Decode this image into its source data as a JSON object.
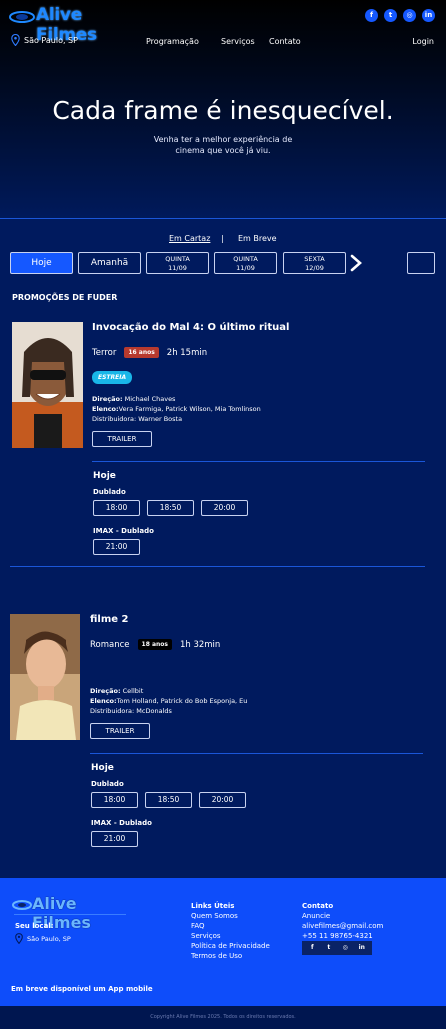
{
  "header": {
    "logo_text": "Alive Filmes",
    "socials": [
      {
        "icon": "facebook-icon",
        "glyph": "f"
      },
      {
        "icon": "twitter-icon",
        "glyph": "t"
      },
      {
        "icon": "instagram-icon",
        "glyph": "◎"
      },
      {
        "icon": "linkedin-icon",
        "glyph": "in"
      }
    ],
    "location": "São Paulo, SP",
    "nav": {
      "programacao": "Programação",
      "servicos": "Serviços",
      "contato": "Contato",
      "login": "Login"
    }
  },
  "hero": {
    "title": "Cada frame é inesquecível.",
    "subtitle": "Venha ter a melhor experiência de cinema que você já viu."
  },
  "tabs": {
    "em_cartaz": "Em Cartaz",
    "separator": "|",
    "em_breve": "Em Breve"
  },
  "dates": [
    {
      "label": "Hoje",
      "sub": ""
    },
    {
      "label": "Amanhã",
      "sub": ""
    },
    {
      "label": "QUINTA",
      "sub": "11/09"
    },
    {
      "label": "QUINTA",
      "sub": "11/09"
    },
    {
      "label": "SEXTA",
      "sub": "12/09"
    }
  ],
  "section_title": "PROMOÇÕES DE FUDER",
  "movies": [
    {
      "title": "Invocação do Mal 4: O último ritual",
      "genre": "Terror",
      "rating": "16 anos",
      "rating_color": "#c0392b",
      "duration": "2h 15min",
      "badge": "ESTREIA",
      "direcao_label": "Direção:",
      "direcao": " Michael Chaves",
      "elenco_label": "Elenco:",
      "elenco": "Vera Farmiga, Patrick Wilson, Mia Tomlinson",
      "distribuidora": "Distribuidora: Warner Bosta",
      "trailer": "TRAILER",
      "day": "Hoje",
      "sessions": [
        {
          "type": "Dublado",
          "times": [
            "18:00",
            "18:50",
            "20:00"
          ]
        },
        {
          "type": "IMAX - Dublado",
          "times": [
            "21:00"
          ]
        }
      ]
    },
    {
      "title": "filme 2",
      "genre": "Romance",
      "rating": "18 anos",
      "rating_color": "#000000",
      "duration": "1h 32min",
      "direcao_label": "Direção:",
      "direcao": " Cellbit",
      "elenco_label": "Elenco:",
      "elenco": "Tom Holland, Patrick do Bob Esponja, Eu",
      "distribuidora": "Distribuidora: McDonalds",
      "trailer": "TRAILER",
      "day": "Hoje",
      "sessions": [
        {
          "type": "Dublado",
          "times": [
            "18:00",
            "18:50",
            "20:00"
          ]
        },
        {
          "type": "IMAX - Dublado",
          "times": [
            "21:00"
          ]
        }
      ]
    }
  ],
  "footer": {
    "logo_text": "Alive Filmes",
    "seu_local": "Seu local:",
    "location": "São Paulo, SP",
    "links_title": "Links Úteis",
    "links": [
      "Quem Somos",
      "FAQ",
      "Serviços",
      "Política de Privacidade",
      "Termos de Uso"
    ],
    "contato_title": "Contato",
    "contato": [
      "Anuncie",
      "alivefilmes@gmail.com",
      "+55 11 98765-4321"
    ],
    "socials": [
      "f",
      "t",
      "◎",
      "in"
    ],
    "app_note": "Em breve disponível um App mobile",
    "copyright": "Copyright Alive Filmes 2025. Todos os direitos reservados."
  }
}
